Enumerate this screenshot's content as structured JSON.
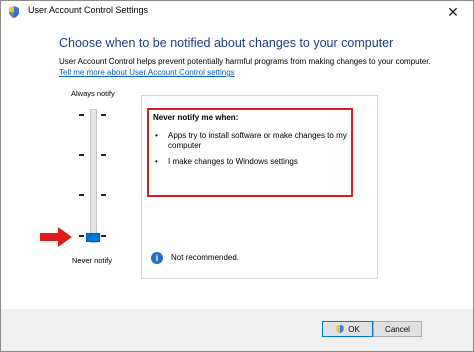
{
  "window": {
    "title": "User Account Control Settings"
  },
  "heading": "Choose when to be notified about changes to your computer",
  "description": "User Account Control helps prevent potentially harmful programs from making changes to your computer.",
  "learn_more_link": "Tell me more about User Account Control settings",
  "slider": {
    "top_label": "Always notify",
    "bottom_label": "Never notify",
    "selected_level": 0,
    "total_levels": 4
  },
  "info_box": {
    "title": "Never notify me when:",
    "items": [
      "Apps try to install software or make changes to my computer",
      "I make changes to Windows settings"
    ],
    "recommendation": "Not recommended."
  },
  "buttons": {
    "ok": "OK",
    "cancel": "Cancel"
  },
  "colors": {
    "heading": "#1e3b8a",
    "link": "#0a5fb4",
    "slider_thumb": "#0078d7",
    "highlight_border": "#e01b1b",
    "arrow": "#e01b1b"
  },
  "icons": {
    "app": "uac-shield-icon",
    "close": "close-icon",
    "info": "info-icon",
    "arrow": "red-arrow-icon",
    "ok_shield": "uac-shield-icon"
  }
}
